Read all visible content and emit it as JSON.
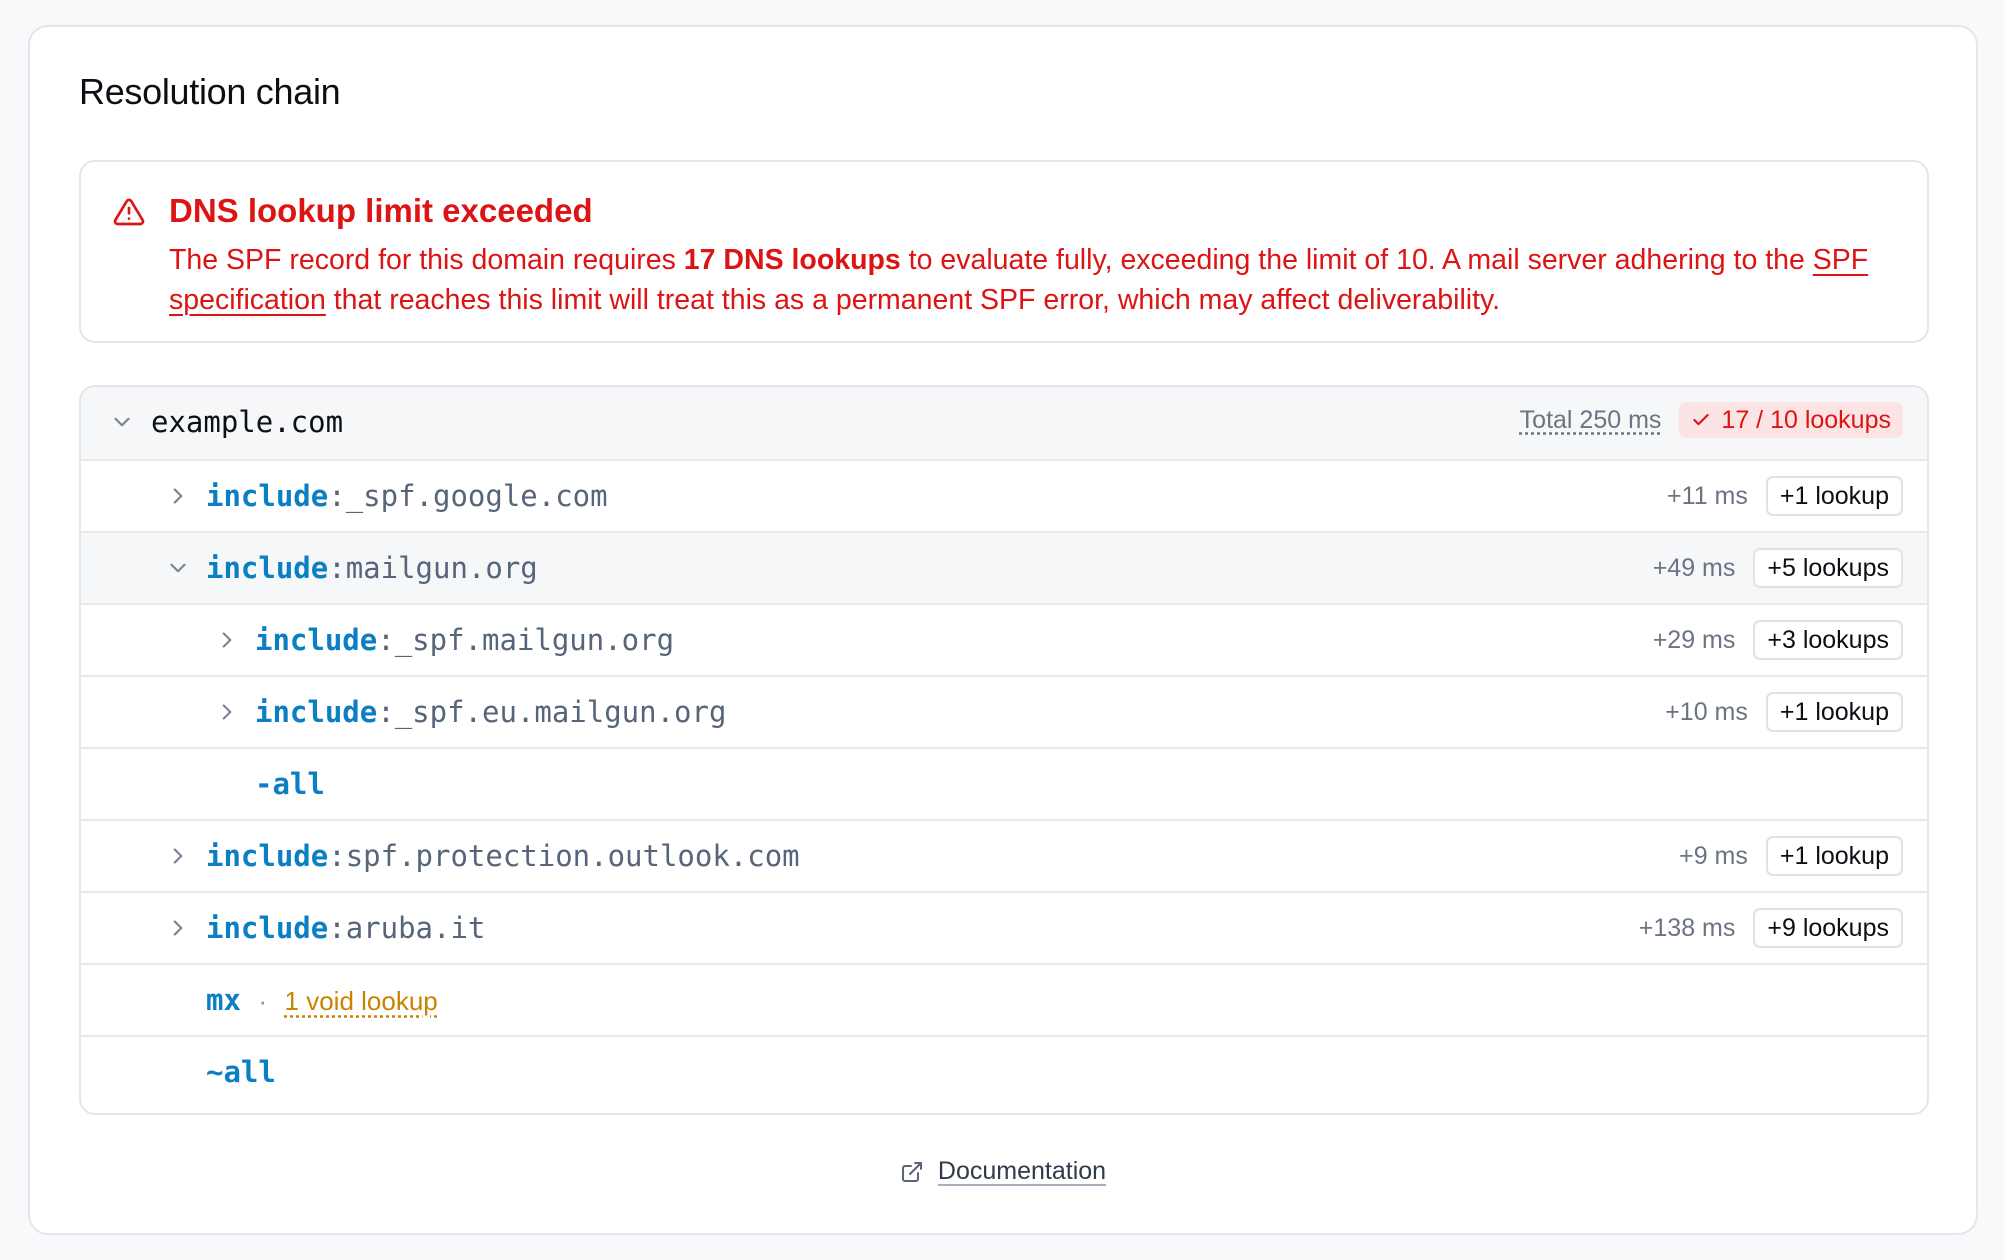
{
  "card": {
    "title": "Resolution chain"
  },
  "alert": {
    "icon": "warning-triangle-icon",
    "title": "DNS lookup limit exceeded",
    "body_prefix": "The SPF record for this domain requires ",
    "body_bold": "17 DNS lookups",
    "body_middle": " to evaluate fully, exceeding the limit of 10. A mail server adhering to the ",
    "body_link": "SPF specification",
    "body_suffix": " that reaches this limit will treat this as a permanent SPF error, which may affect deliverability.",
    "color": "#dc1414"
  },
  "tree": {
    "root": {
      "label": "example.com",
      "total": "Total 250 ms",
      "lookups": "17 / 10 lookups"
    },
    "rows": [
      {
        "keyword": "include",
        "sep": ":",
        "value": "_spf.google.com",
        "ms": "+11 ms",
        "badge": "+1 lookup"
      },
      {
        "keyword": "include",
        "sep": ":",
        "value": "mailgun.org",
        "ms": "+49 ms",
        "badge": "+5 lookups"
      },
      {
        "keyword": "include",
        "sep": ":",
        "value": "_spf.mailgun.org",
        "ms": "+29 ms",
        "badge": "+3 lookups"
      },
      {
        "keyword": "include",
        "sep": ":",
        "value": "_spf.eu.mailgun.org",
        "ms": "+10 ms",
        "badge": "+1 lookup"
      },
      {
        "keyword": "-all"
      },
      {
        "keyword": "include",
        "sep": ":",
        "value": "spf.protection.outlook.com",
        "ms": "+9 ms",
        "badge": "+1 lookup"
      },
      {
        "keyword": "include",
        "sep": ":",
        "value": "aruba.it",
        "ms": "+138 ms",
        "badge": "+9 lookups"
      },
      {
        "keyword": "mx",
        "dot": "·",
        "note": "1 void lookup"
      },
      {
        "keyword": "~all"
      }
    ]
  },
  "footer": {
    "link": "Documentation",
    "icon": "external-link-icon"
  },
  "colors": {
    "keyword": "#0b7fc4",
    "error": "#dc1414",
    "warning": "#c98300"
  }
}
